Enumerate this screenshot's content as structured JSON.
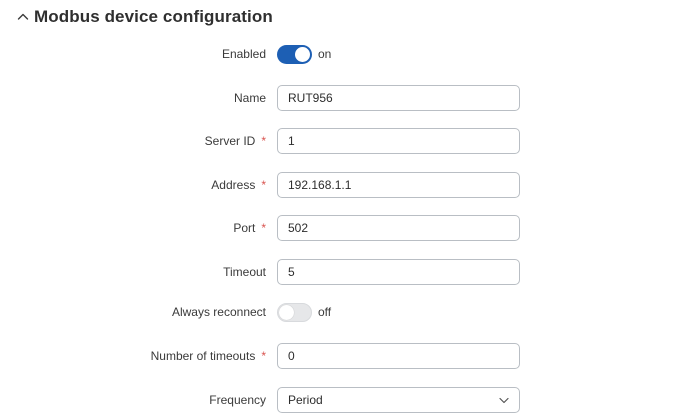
{
  "section": {
    "title": "Modbus device configuration",
    "collapse_icon": "chevron-up-icon"
  },
  "fields": {
    "enabled": {
      "label": "Enabled",
      "state": "on",
      "state_label": "on",
      "accent": "#1d5fb4"
    },
    "name": {
      "label": "Name",
      "value": "RUT956"
    },
    "server_id": {
      "label": "Server ID",
      "required_mark": "*",
      "value": "1"
    },
    "address": {
      "label": "Address",
      "required_mark": "*",
      "value": "192.168.1.1"
    },
    "port": {
      "label": "Port",
      "required_mark": "*",
      "value": "502"
    },
    "timeout": {
      "label": "Timeout",
      "value": "5"
    },
    "always_reconnect": {
      "label": "Always reconnect",
      "state": "off",
      "state_label": "off"
    },
    "number_of_timeouts": {
      "label": "Number of timeouts",
      "required_mark": "*",
      "value": "0"
    },
    "frequency": {
      "label": "Frequency",
      "selected": "Period",
      "icon": "chevron-down-icon"
    }
  }
}
